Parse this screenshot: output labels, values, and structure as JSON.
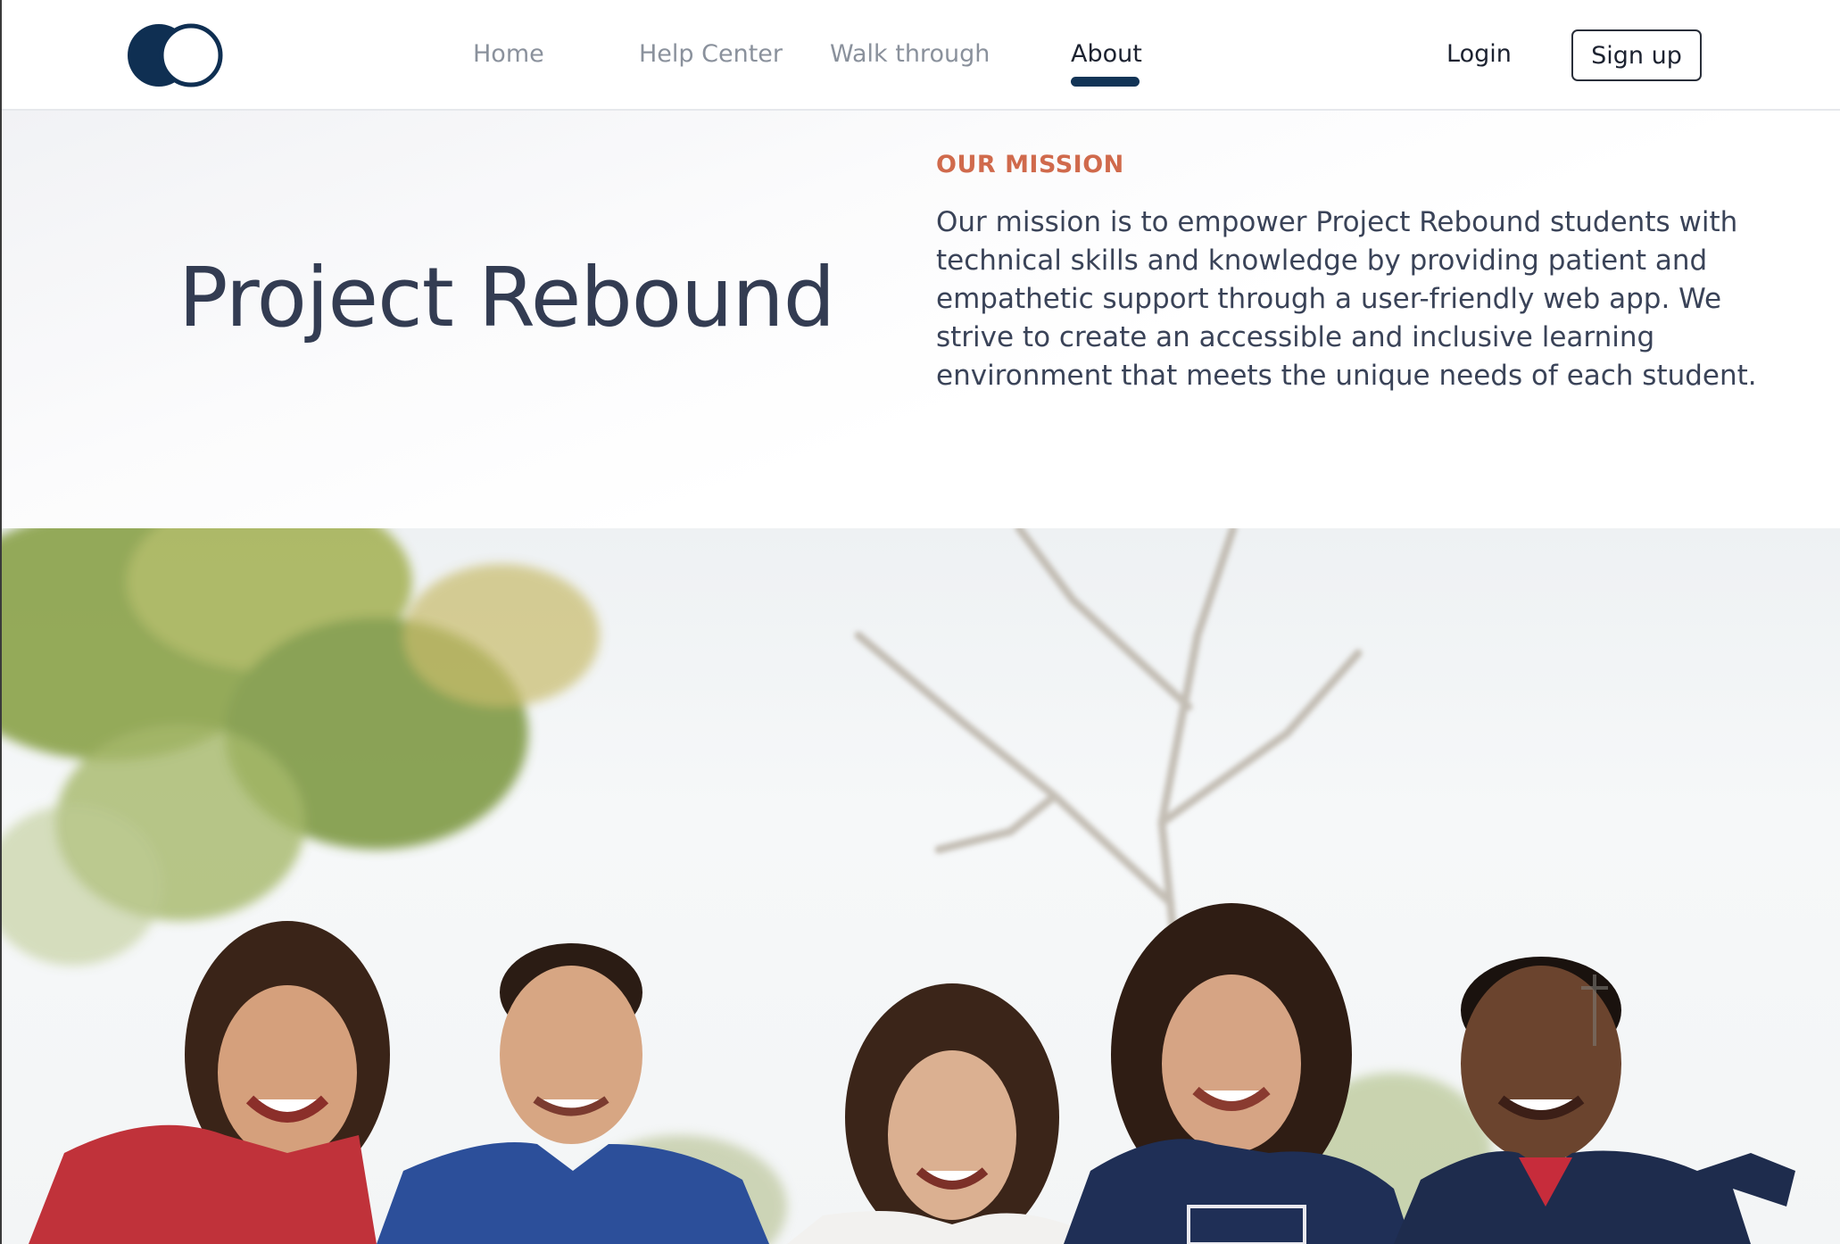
{
  "nav": {
    "links": [
      {
        "label": "Home",
        "active": false
      },
      {
        "label": "Help Center",
        "active": false
      },
      {
        "label": "Walk through",
        "active": false
      },
      {
        "label": "About",
        "active": true
      }
    ],
    "login_label": "Login",
    "signup_label": "Sign up"
  },
  "hero": {
    "title": "Project Rebound",
    "eyebrow": "OUR MISSION",
    "mission_text": "Our mission is to empower Project Rebound students with technical skills and knowledge by providing patient and empathetic support through a user-friendly web app. We strive to create an accessible and inclusive learning environment that meets the unique needs of each student."
  },
  "colors": {
    "brand_navy": "#0f2f52",
    "accent_orange": "#d06a4c",
    "active_underline": "#123456",
    "text_dark": "#333c52",
    "nav_inactive": "#8a919c"
  },
  "photo": {
    "icon": "group-photo-image"
  }
}
